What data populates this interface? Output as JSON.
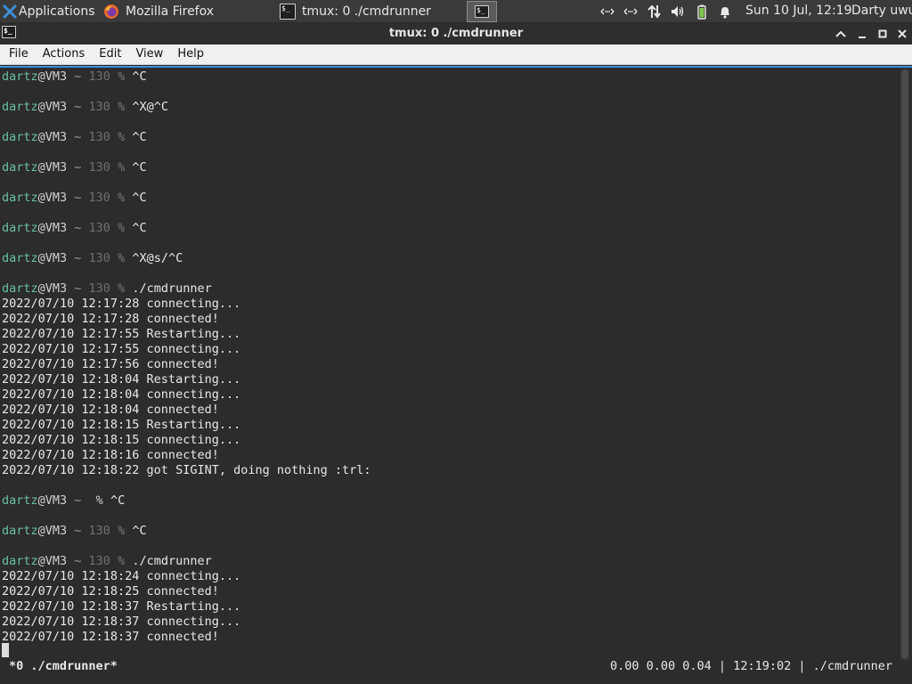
{
  "panel": {
    "applications_label": "Applications",
    "tasks": [
      {
        "label": "Mozilla Firefox",
        "icon": "firefox-icon",
        "active": false
      },
      {
        "label": "tmux: 0 ./cmdrunner",
        "icon": "terminal-icon",
        "active": false
      }
    ],
    "clock": "Sun 10 Jul, 12:19",
    "user": "Darty uwu"
  },
  "window": {
    "title": "tmux: 0 ./cmdrunner"
  },
  "menubar": {
    "items": [
      "File",
      "Actions",
      "Edit",
      "View",
      "Help"
    ]
  },
  "prompt": {
    "user": "dartz",
    "host": "@VM3",
    "dir": " ~ ",
    "status": "130",
    "symbol": " % "
  },
  "terminal": {
    "lines": [
      {
        "type": "prompt",
        "status": "130",
        "cmd": "^C"
      },
      {
        "type": "blank"
      },
      {
        "type": "prompt",
        "status": "130",
        "cmd": "^X@^C"
      },
      {
        "type": "blank"
      },
      {
        "type": "prompt",
        "status": "130",
        "cmd": "^C"
      },
      {
        "type": "blank"
      },
      {
        "type": "prompt",
        "status": "130",
        "cmd": "^C"
      },
      {
        "type": "blank"
      },
      {
        "type": "prompt",
        "status": "130",
        "cmd": "^C"
      },
      {
        "type": "blank"
      },
      {
        "type": "prompt",
        "status": "130",
        "cmd": "^C"
      },
      {
        "type": "blank"
      },
      {
        "type": "prompt",
        "status": "130",
        "cmd": "^X@s/^C"
      },
      {
        "type": "blank"
      },
      {
        "type": "prompt",
        "status": "130",
        "cmd": "./cmdrunner"
      },
      {
        "type": "output",
        "text": "2022/07/10 12:17:28 connecting..."
      },
      {
        "type": "output",
        "text": "2022/07/10 12:17:28 connected!"
      },
      {
        "type": "output",
        "text": "2022/07/10 12:17:55 Restarting..."
      },
      {
        "type": "output",
        "text": "2022/07/10 12:17:55 connecting..."
      },
      {
        "type": "output",
        "text": "2022/07/10 12:17:56 connected!"
      },
      {
        "type": "output",
        "text": "2022/07/10 12:18:04 Restarting..."
      },
      {
        "type": "output",
        "text": "2022/07/10 12:18:04 connecting..."
      },
      {
        "type": "output",
        "text": "2022/07/10 12:18:04 connected!"
      },
      {
        "type": "output",
        "text": "2022/07/10 12:18:15 Restarting..."
      },
      {
        "type": "output",
        "text": "2022/07/10 12:18:15 connecting..."
      },
      {
        "type": "output",
        "text": "2022/07/10 12:18:16 connected!"
      },
      {
        "type": "output",
        "text": "2022/07/10 12:18:22 got SIGINT, doing nothing :trl:"
      },
      {
        "type": "blank"
      },
      {
        "type": "prompt",
        "status": "",
        "cmd": "^C"
      },
      {
        "type": "blank"
      },
      {
        "type": "prompt",
        "status": "130",
        "cmd": "^C"
      },
      {
        "type": "blank"
      },
      {
        "type": "prompt",
        "status": "130",
        "cmd": "./cmdrunner"
      },
      {
        "type": "output",
        "text": "2022/07/10 12:18:24 connecting..."
      },
      {
        "type": "output",
        "text": "2022/07/10 12:18:25 connected!"
      },
      {
        "type": "output",
        "text": "2022/07/10 12:18:37 Restarting..."
      },
      {
        "type": "output",
        "text": "2022/07/10 12:18:37 connecting..."
      },
      {
        "type": "output",
        "text": "2022/07/10 12:18:37 connected!"
      }
    ]
  },
  "tmux_status": {
    "left": "*0 ./cmdrunner*",
    "right": "0.00 0.00 0.04 | 12:19:02 | ./cmdrunner"
  },
  "colors": {
    "prompt_user": "#6abfa0",
    "accent": "#3b8fd9",
    "terminal_bg": "#2c2c2c"
  }
}
